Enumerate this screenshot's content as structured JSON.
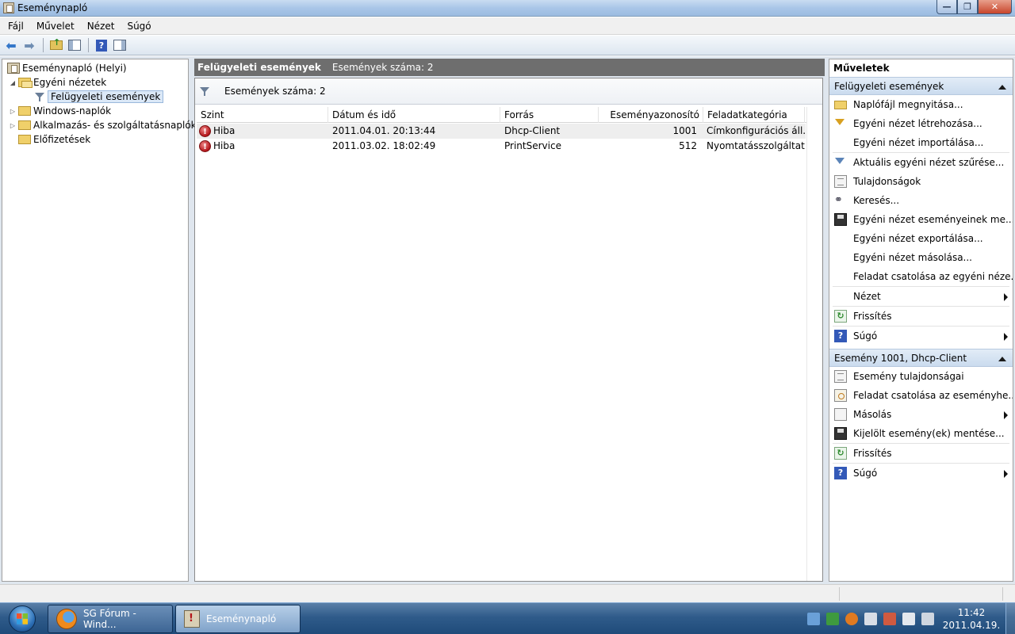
{
  "window": {
    "title": "Eseménynapló"
  },
  "menubar": {
    "items": [
      "Fájl",
      "Művelet",
      "Nézet",
      "Súgó"
    ]
  },
  "tree": {
    "root": "Eseménynapló (Helyi)",
    "custom_views": "Egyéni nézetek",
    "admin_events": "Felügyeleti események",
    "windows_logs": "Windows-naplók",
    "app_logs": "Alkalmazás- és szolgáltatásnaplók",
    "subscriptions": "Előfizetések"
  },
  "center": {
    "header_title": "Felügyeleti események",
    "header_count": "Események száma: 2",
    "filter_text": "Események száma: 2",
    "columns": [
      "Szint",
      "Dátum és idő",
      "Forrás",
      "Eseményazonosító",
      "Feladatkategória"
    ],
    "rows": [
      {
        "level": "Hiba",
        "datetime": "2011.04.01. 20:13:44",
        "source": "Dhcp-Client",
        "id": "1001",
        "category": "Címkonfigurációs áll..."
      },
      {
        "level": "Hiba",
        "datetime": "2011.03.02. 18:02:49",
        "source": "PrintService",
        "id": "512",
        "category": "Nyomtatásszolgáltat..."
      }
    ]
  },
  "actions": {
    "title": "Műveletek",
    "section1": {
      "title": "Felügyeleti események",
      "items": [
        "Naplófájl megnyitása...",
        "Egyéni nézet létrehozása...",
        "Egyéni nézet importálása...",
        "Aktuális egyéni nézet szűrése...",
        "Tulajdonságok",
        "Keresés...",
        "Egyéni nézet eseményeinek me...",
        "Egyéni nézet exportálása...",
        "Egyéni nézet másolása...",
        "Feladat csatolása az egyéni néze...",
        "Nézet",
        "Frissítés",
        "Súgó"
      ]
    },
    "section2": {
      "title": "Esemény 1001, Dhcp-Client",
      "items": [
        "Esemény tulajdonságai",
        "Feladat csatolása az eseményhe...",
        "Másolás",
        "Kijelölt esemény(ek) mentése...",
        "Frissítés",
        "Súgó"
      ]
    }
  },
  "taskbar": {
    "firefox_label": "SG Fórum - Wind...",
    "eventlog_label": "Eseménynapló",
    "time": "11:42",
    "date": "2011.04.19."
  }
}
